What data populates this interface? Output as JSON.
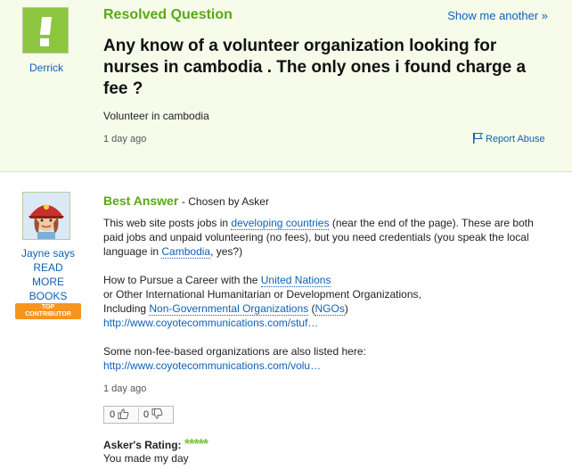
{
  "question": {
    "status": "Resolved Question",
    "show_another": "Show me another »",
    "asker": "Derrick",
    "title": "Any know of a volunteer organization looking for nurses in cambodia . The only ones i found charge a fee ?",
    "detail": "Volunteer in cambodia",
    "time": "1 day ago",
    "report": "Report Abuse",
    "flag_icon": "flag-icon"
  },
  "answer": {
    "best_label": "Best Answer",
    "chosen_by": "- Chosen by Asker",
    "answerer_says": "Jayne says",
    "answerer_lines": [
      "READ",
      "MORE",
      "BOOKS"
    ],
    "badge_top": "TOP",
    "badge_bottom": "CONTRIBUTOR",
    "p1_before": "This web site posts jobs in ",
    "p1_link1": "developing countries",
    "p1_mid": " (near the end of the page). These are both paid jobs and unpaid volunteering (no fees), but you need credentials (you speak the local language in ",
    "p1_link2": "Cambodia",
    "p1_after": ", yes?)",
    "p2_l1_before": "How to Pursue a Career with the ",
    "p2_l1_link": "United Nations",
    "p2_l2": "or Other International Humanitarian or Development Organizations,",
    "p2_l3_before": "Including ",
    "p2_l3_link1": "Non-Governmental Organizations",
    "p2_l3_mid": " (",
    "p2_l3_link2": "NGOs",
    "p2_l3_after": ")",
    "p2_url": "http://www.coyotecommunications.com/stuf…",
    "p3_text": "Some non-fee-based organizations are also listed here:",
    "p3_url": "http://www.coyotecommunications.com/volu…",
    "time": "1 day ago",
    "thumbs_up_count": "0",
    "thumbs_down_count": "0",
    "rating_label": "Asker's Rating:",
    "rating_stars": "*****",
    "rating_value": 5,
    "comment": "You made my day"
  },
  "colors": {
    "green": "#5aaa12",
    "link": "#0d61b8",
    "badge": "#f7941e",
    "question_bg": "#f7fbea"
  }
}
